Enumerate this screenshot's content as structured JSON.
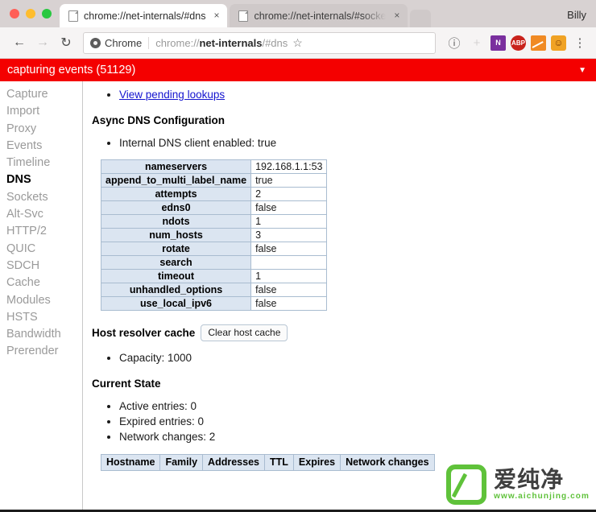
{
  "window": {
    "traffic_lights": [
      "close",
      "minimize",
      "zoom"
    ],
    "profile_name": "Billy"
  },
  "tabs": [
    {
      "title": "chrome://net-internals/#dns",
      "active": true,
      "close_label": "×"
    },
    {
      "title": "chrome://net-internals/#socke",
      "active": false,
      "close_label": "×"
    }
  ],
  "toolbar": {
    "back_glyph": "←",
    "forward_glyph": "→",
    "reload_glyph": "↻",
    "chrome_badge_label": "Chrome",
    "url_prefix": "chrome://",
    "url_bold": "net-internals",
    "url_suffix": "/#dns",
    "star_glyph": "☆",
    "info_glyph": "ⓘ",
    "plus_glyph": "+",
    "extension_onenote_label": "N",
    "extension_abp_label": "ABP",
    "extension_pumpkin_glyph": "☺",
    "menu_glyph": "⋮"
  },
  "capture_banner": {
    "text": "capturing events (51129)",
    "caret_glyph": "▼",
    "color": "#f40000"
  },
  "sidebar": {
    "items": [
      {
        "label": "Capture",
        "selected": false
      },
      {
        "label": "Import",
        "selected": false
      },
      {
        "label": "Proxy",
        "selected": false
      },
      {
        "label": "Events",
        "selected": false
      },
      {
        "label": "Timeline",
        "selected": false
      },
      {
        "label": "DNS",
        "selected": true
      },
      {
        "label": "Sockets",
        "selected": false
      },
      {
        "label": "Alt-Svc",
        "selected": false
      },
      {
        "label": "HTTP/2",
        "selected": false
      },
      {
        "label": "QUIC",
        "selected": false
      },
      {
        "label": "SDCH",
        "selected": false
      },
      {
        "label": "Cache",
        "selected": false
      },
      {
        "label": "Modules",
        "selected": false
      },
      {
        "label": "HSTS",
        "selected": false
      },
      {
        "label": "Bandwidth",
        "selected": false
      },
      {
        "label": "Prerender",
        "selected": false
      }
    ]
  },
  "content": {
    "pending_lookups_link": "View pending lookups",
    "async_dns_heading": "Async DNS Configuration",
    "internal_dns_client": "Internal DNS client enabled: true",
    "dns_config_table": [
      {
        "key": "nameservers",
        "value": "192.168.1.1:53"
      },
      {
        "key": "append_to_multi_label_name",
        "value": "true"
      },
      {
        "key": "attempts",
        "value": "2"
      },
      {
        "key": "edns0",
        "value": "false"
      },
      {
        "key": "ndots",
        "value": "1"
      },
      {
        "key": "num_hosts",
        "value": "3"
      },
      {
        "key": "rotate",
        "value": "false"
      },
      {
        "key": "search",
        "value": ""
      },
      {
        "key": "timeout",
        "value": "1"
      },
      {
        "key": "unhandled_options",
        "value": "false"
      },
      {
        "key": "use_local_ipv6",
        "value": "false"
      }
    ],
    "host_resolver_cache_title": "Host resolver cache",
    "clear_host_cache_button": "Clear host cache",
    "capacity_line": "Capacity: 1000",
    "current_state_heading": "Current State",
    "state_lines": [
      "Active entries: 0",
      "Expired entries: 0",
      "Network changes: 2"
    ],
    "cache_table_headers": [
      "Hostname",
      "Family",
      "Addresses",
      "TTL",
      "Expires",
      "Network changes"
    ]
  },
  "watermark": {
    "cn_text": "爱纯净",
    "url_text": "www.aichunjing.com",
    "accent": "#5fc23a"
  }
}
